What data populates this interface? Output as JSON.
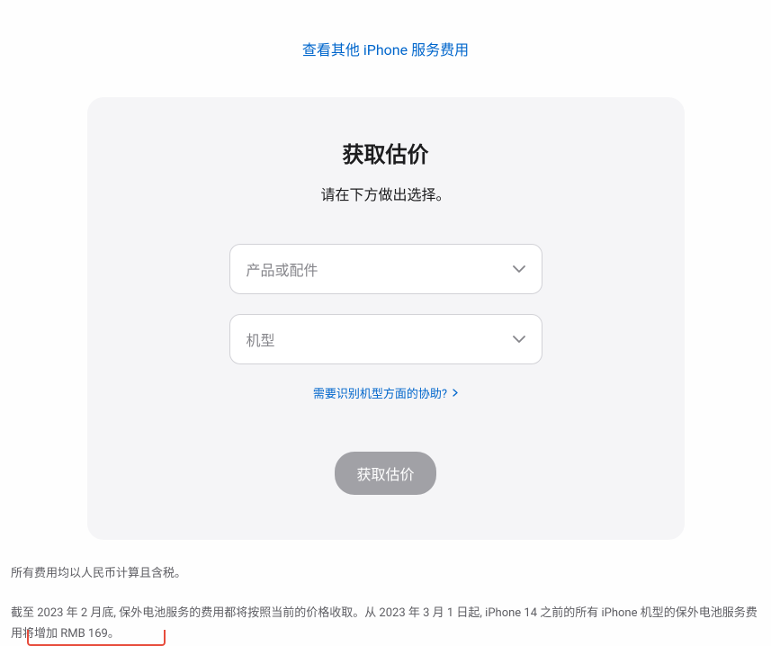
{
  "top_link": "查看其他 iPhone 服务费用",
  "card": {
    "title": "获取估价",
    "subtitle": "请在下方做出选择。",
    "select1_placeholder": "产品或配件",
    "select2_placeholder": "机型",
    "help_link": "需要识别机型方面的协助?",
    "submit_label": "获取估价"
  },
  "footer": {
    "line1": "所有费用均以人民币计算且含税。",
    "line2": "截至 2023 年 2 月底, 保外电池服务的费用都将按照当前的价格收取。从 2023 年 3 月 1 日起, iPhone 14 之前的所有 iPhone 机型的保外电池服务费用将增加 RMB 169。"
  }
}
